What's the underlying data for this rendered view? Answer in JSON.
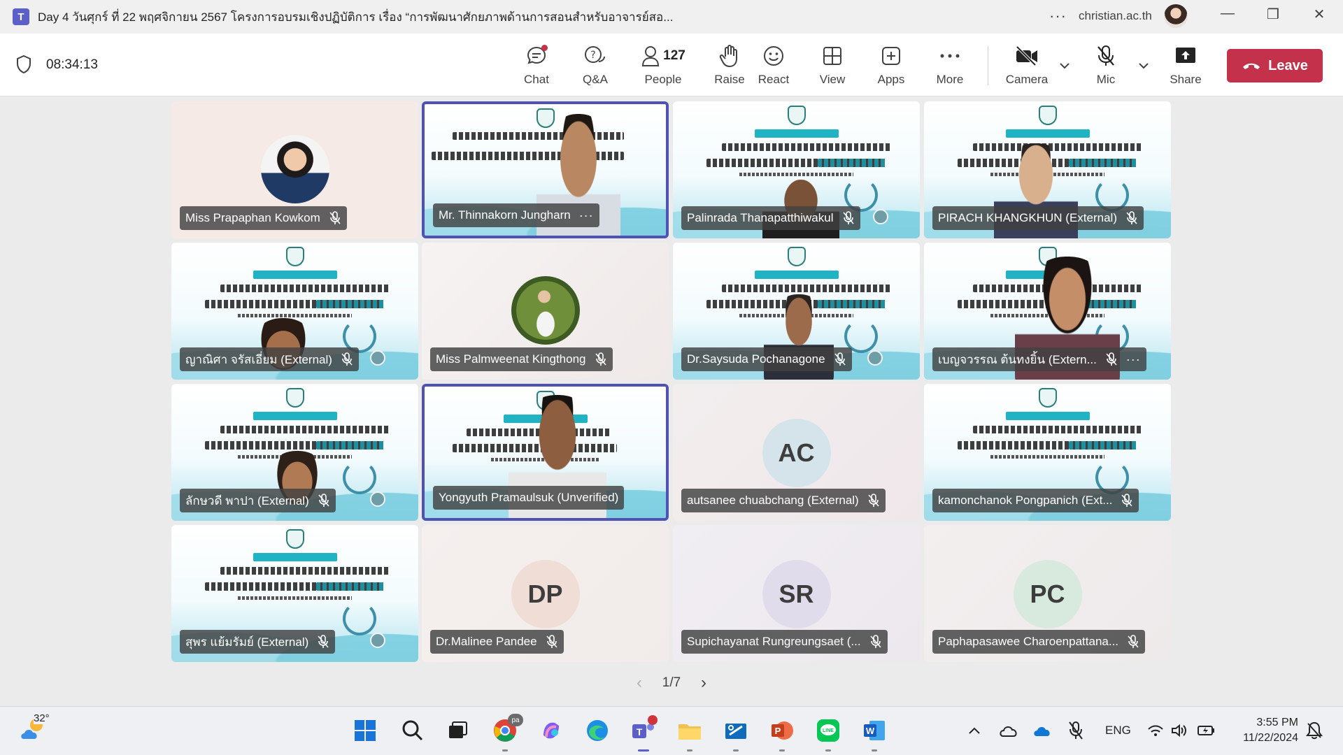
{
  "window": {
    "title": "Day 4 วันศุกร์ ที่ 22 พฤศจิกายน 2567 โครงการอบรมเชิงปฏิบัติการ เรื่อง “การพัฒนาศักยภาพด้านการสอนสำหรับอาจารย์สอ...",
    "account": "christian.ac.th",
    "controls": {
      "minimize": "—",
      "restore": "❐",
      "close": "✕"
    },
    "more": "···"
  },
  "meeting": {
    "elapsed": "08:34:13",
    "toolbar": {
      "chat": "Chat",
      "qa": "Q&A",
      "people": "People",
      "people_count": "127",
      "raise": "Raise",
      "react": "React",
      "view": "View",
      "apps": "Apps",
      "more": "More",
      "camera": "Camera",
      "mic": "Mic",
      "share": "Share",
      "leave": "Leave"
    }
  },
  "participants": [
    {
      "name": "Miss Prapaphan Kowkom",
      "type": "photo"
    },
    {
      "name": "Mr. Thinnakorn Jungharn",
      "type": "video",
      "active": true,
      "more": "···"
    },
    {
      "name": "Palinrada Thanapatthiwakul",
      "type": "slide"
    },
    {
      "name": "PIRACH KHANGKHUN (External)",
      "type": "slide"
    },
    {
      "name": "ญาณิศา จรัสเอี่ยม (External)",
      "type": "slide"
    },
    {
      "name": "Miss Palmweenat Kingthong",
      "type": "photo"
    },
    {
      "name": "Dr.Saysuda Pochanagone",
      "type": "slide"
    },
    {
      "name": "เบญจวรรณ ต้นทงยิ้น (Extern...",
      "type": "slide",
      "more": "···"
    },
    {
      "name": "ลักษวดี พาปา (External)",
      "type": "slide"
    },
    {
      "name": "Yongyuth Pramaulsuk (Unverified)",
      "type": "video",
      "active": true
    },
    {
      "name": "autsanee chuabchang (External)",
      "type": "initials",
      "initials": "AC"
    },
    {
      "name": "kamonchanok Pongpanich (Ext...",
      "type": "slide"
    },
    {
      "name": "สุพร แย้มรัมย์ (External)",
      "type": "slide"
    },
    {
      "name": "Dr.Malinee Pandee",
      "type": "initials",
      "initials": "DP"
    },
    {
      "name": "Supichayanat Rungreungsaet (...",
      "type": "initials",
      "initials": "SR"
    },
    {
      "name": "Paphapasawee Charoenpattana...",
      "type": "initials",
      "initials": "PC"
    }
  ],
  "pager": {
    "label": "1/7",
    "prev": "‹",
    "next": "›"
  },
  "taskbar": {
    "temperature": "32°",
    "language": "ENG",
    "time": "3:55 PM",
    "date": "11/22/2024",
    "chrome_badge": "pa"
  },
  "colors": {
    "teams_purple": "#5b5fc7",
    "active_speaker_border": "#4f52b2",
    "leave_red": "#c4314b",
    "label_bg": "#414141"
  }
}
